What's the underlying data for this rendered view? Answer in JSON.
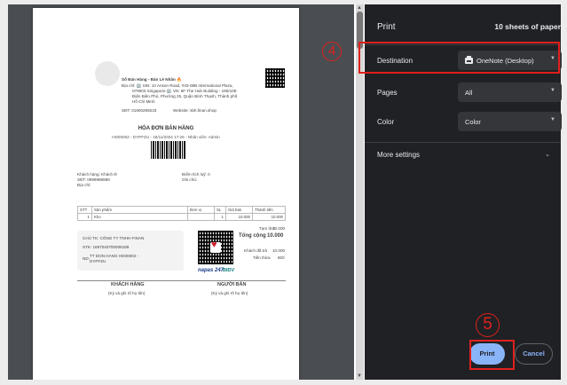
{
  "dialog": {
    "title": "Print",
    "sheets": "10 sheets of paper"
  },
  "settings": {
    "destination": {
      "label": "Destination",
      "value": "OneNote (Desktop)"
    },
    "pages": {
      "label": "Pages",
      "value": "All"
    },
    "color": {
      "label": "Color",
      "value": "Color"
    },
    "more": "More settings"
  },
  "buttons": {
    "print": "Print",
    "cancel": "Cancel"
  },
  "annotations": {
    "step4": "4",
    "step5": "5"
  },
  "receipt": {
    "store": "Số Bán Hàng - Bán Lẻ Nhân 🔥",
    "address1": "Địa chỉ: 🏢 SIN: 10 Anson Road, #33-08B International Plaza,",
    "address2": "079903 Singapore 🏢 VN: 6F The Hub Building - 195/10E",
    "address3": "Điện Biên Phủ, Phường 25, Quận Bình Thạnh, Thành phố",
    "address4": "Hồ Chí Minh",
    "phone": "SĐT: 01900299233",
    "website": "Website: sbh.finan.shop",
    "title": "HÓA ĐƠN BÁN HÀNG",
    "subtitle": "HD00002 - DYPFZU - 18/11/2024 17:26 - Nhân viên: Admin",
    "customer": "Khách hàng: Khách lẻ",
    "customer_phone": "SĐT: 0999988888",
    "customer_addr": "Địa chỉ:",
    "points": "Điểm tích luỹ: 0",
    "note": "Ghi chú:",
    "columns": [
      "STT",
      "Sản phẩm",
      "Đơn vị",
      "SL",
      "Giá bán",
      "Thành tiền"
    ],
    "rows": [
      [
        "1",
        "Kho",
        "",
        "1",
        "10.000",
        "10.000"
      ]
    ],
    "bank_owner": "CHỦ TK: CÔNG TY TNHH FINAN",
    "bank_no": "STK: 1697040700008189",
    "bank_note_line1": "TT DON HANG HD00002 -",
    "bank_note_line2": "DYPFZU",
    "bank_note_label": "ND:",
    "subtotal_label": "Tạm tính",
    "subtotal": "10.000",
    "total_label": "Tổng cộng",
    "total": "10.000",
    "paid_label": "Khách đã trả",
    "paid": "10.000",
    "change_label": "Tiền thừa",
    "change": "800",
    "napas": "napas 247",
    "bidv": "BIDV",
    "sign_customer": "KHÁCH HÀNG",
    "sign_customer_note": "(Ký và ghi rõ họ tên)",
    "sign_seller": "NGƯỜI BÁN",
    "sign_seller_note": "(Ký và ghi rõ họ tên)"
  },
  "colors": {
    "annotation": "#e0201d",
    "accent": "#8ab4f8",
    "panel": "#202124"
  }
}
